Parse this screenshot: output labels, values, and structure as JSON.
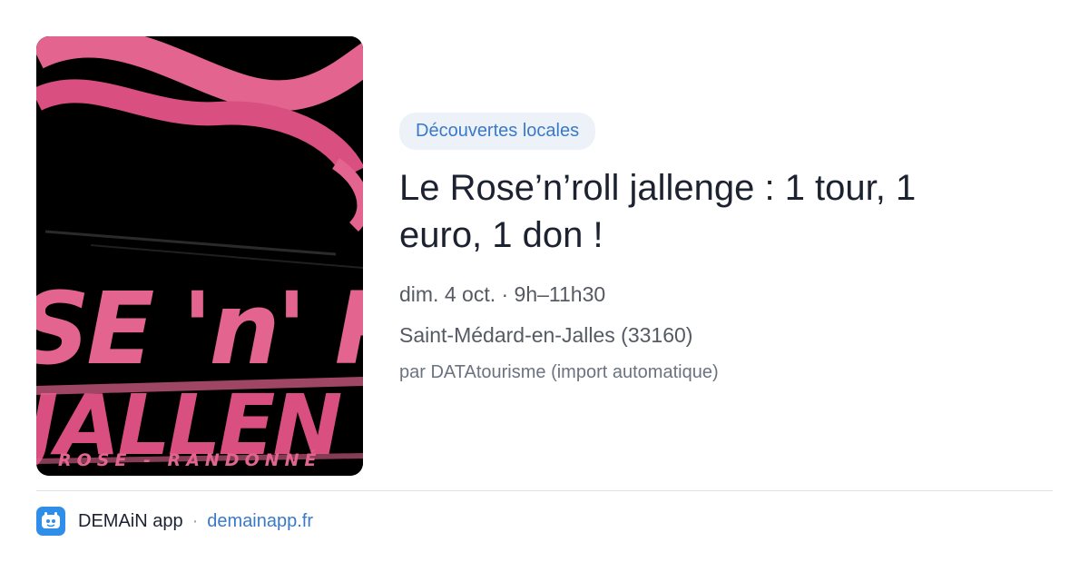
{
  "poster": {
    "headline_text": "SE 'n' R",
    "subline_text": "JALLEN",
    "caption": "ROSE - RANDONNÉ"
  },
  "category_tag": "Découvertes locales",
  "event": {
    "title": "Le Rose’n’roll jallenge : 1 tour, 1 euro, 1 don !",
    "datetime": "dim. 4 oct. · 9h–11h30",
    "location": "Saint-Médard-en-Jalles (33160)",
    "source": "par DATAtourisme (import automatique)"
  },
  "footer": {
    "app_name": "DEMAiN app",
    "separator": "·",
    "domain": "demainapp.fr"
  },
  "colors": {
    "tag_bg": "#edf2f9",
    "tag_text": "#3a79c9",
    "title": "#1d2230",
    "link": "#3a79c9",
    "poster_pink": "#e2648f"
  }
}
